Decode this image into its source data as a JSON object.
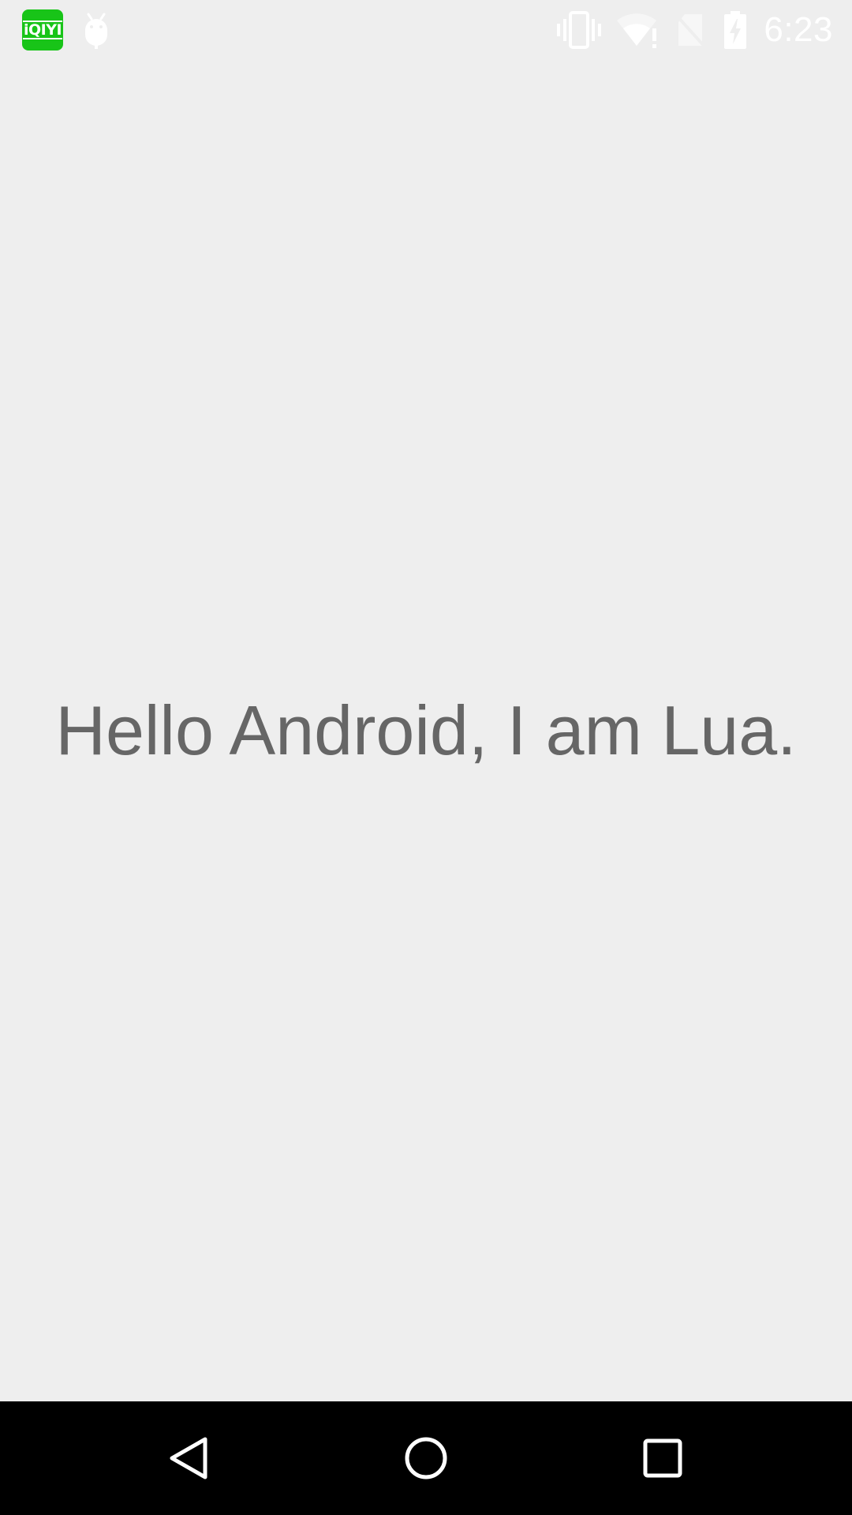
{
  "status_bar": {
    "app_badge_text": "iQIYI",
    "app_badge_color": "#18c418",
    "time": "6:23",
    "icons": {
      "left": [
        "iqiyi-app-icon",
        "android-debug-icon"
      ],
      "right": [
        "vibrate-icon",
        "wifi-alert-icon",
        "no-sim-icon",
        "battery-charging-icon"
      ]
    },
    "icon_color": "#ffffff"
  },
  "main": {
    "message": "Hello Android, I am Lua.",
    "text_color": "#666666",
    "background": "#eeeeee"
  },
  "nav_bar": {
    "background": "#000000",
    "buttons": [
      "back-button",
      "home-button",
      "recents-button"
    ]
  }
}
